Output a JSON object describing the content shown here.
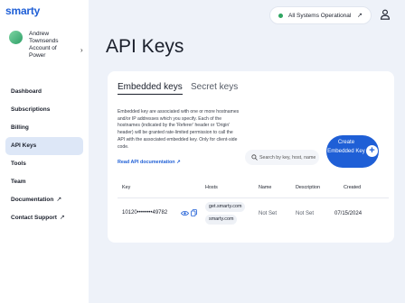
{
  "brand": {
    "logo": "smarty"
  },
  "account": {
    "name": "Andrew Townsends Account of Power"
  },
  "nav": [
    {
      "label": "Dashboard",
      "external": false,
      "active": false
    },
    {
      "label": "Subscriptions",
      "external": false,
      "active": false
    },
    {
      "label": "Billing",
      "external": false,
      "active": false
    },
    {
      "label": "API Keys",
      "external": false,
      "active": true
    },
    {
      "label": "Tools",
      "external": false,
      "active": false
    },
    {
      "label": "Team",
      "external": false,
      "active": false
    },
    {
      "label": "Documentation",
      "external": true,
      "active": false
    },
    {
      "label": "Contact Support",
      "external": true,
      "active": false
    }
  ],
  "status": {
    "text": "All Systems Operational",
    "color": "#2fa561"
  },
  "page": {
    "title": "API Keys"
  },
  "tabs": {
    "embedded": "Embedded keys",
    "secret": "Secret keys"
  },
  "description": "Embedded key are associated with one or more hostnames and/or IP addresses which you specify. Each of the hostnames (indicated by the 'Referer' header or 'Origin' header) will be granted rate-limited permission to call the API with the associated embedded key. Only for client-side code.",
  "docs_link": "Read API documentation",
  "search": {
    "placeholder": "Search by key, host, name"
  },
  "create_button": {
    "label": "Create Embedded Key"
  },
  "table": {
    "headers": {
      "key": "Key",
      "hosts": "Hosts",
      "name": "Name",
      "description": "Description",
      "created": "Created"
    },
    "rows": [
      {
        "key": "10120••••••••49782",
        "hosts": [
          "get.smarty.com",
          "smarty.com"
        ],
        "name": "Not Set",
        "description": "Not Set",
        "created": "07/15/2024"
      }
    ]
  },
  "colors": {
    "accent": "#1f5fd6",
    "active_nav_bg": "#dde7f7",
    "page_bg": "#eef2f9"
  },
  "icons": {
    "status": "status-dot-icon",
    "external": "external-link-icon",
    "user": "user-icon",
    "search": "search-icon",
    "eye": "eye-icon",
    "copy": "copy-icon",
    "plus": "plus-icon",
    "chevron": "chevron-right-icon"
  }
}
